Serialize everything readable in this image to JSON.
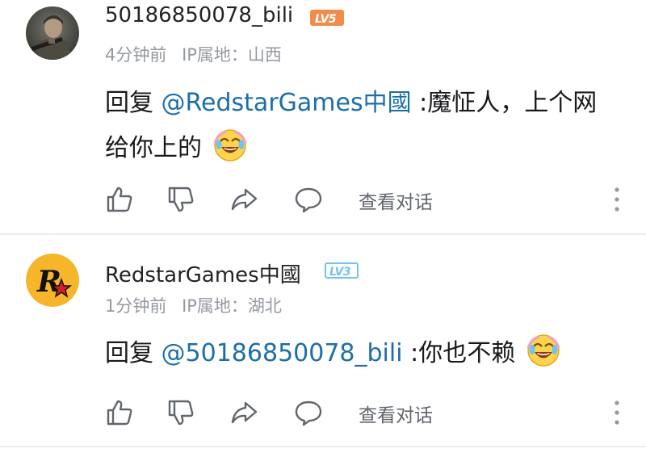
{
  "comments": [
    {
      "username": "50186850078_bili",
      "level": "LV5",
      "time": "4分钟前",
      "ip_location": "IP属地：山西",
      "reply_prefix": "回复",
      "mention": "@RedstarGames中國",
      "text": ":魔怔人，上个网给你上的",
      "emoji": "crying-laughing-emoji",
      "actions": {
        "like_icon": "thumbs-up-icon",
        "dislike_icon": "thumbs-down-icon",
        "share_icon": "share-icon",
        "reply_icon": "comment-icon",
        "view_conversation": "查看对话",
        "more_icon": "more-vertical-icon"
      }
    },
    {
      "username": "RedstarGames中國",
      "level": "LV3",
      "time": "1分钟前",
      "ip_location": "IP属地：湖北",
      "reply_prefix": "回复",
      "mention": "@50186850078_bili",
      "text": ":你也不赖",
      "emoji": "crying-laughing-emoji",
      "actions": {
        "like_icon": "thumbs-up-icon",
        "dislike_icon": "thumbs-down-icon",
        "share_icon": "share-icon",
        "reply_icon": "comment-icon",
        "view_conversation": "查看对话",
        "more_icon": "more-vertical-icon"
      }
    }
  ],
  "colors": {
    "mention": "#1c6fa6",
    "meta_text": "#9499a0",
    "level5_badge": "#f28c4b",
    "level3_badge": "#74c3ec",
    "rockstar_yellow": "#f7b52c"
  }
}
